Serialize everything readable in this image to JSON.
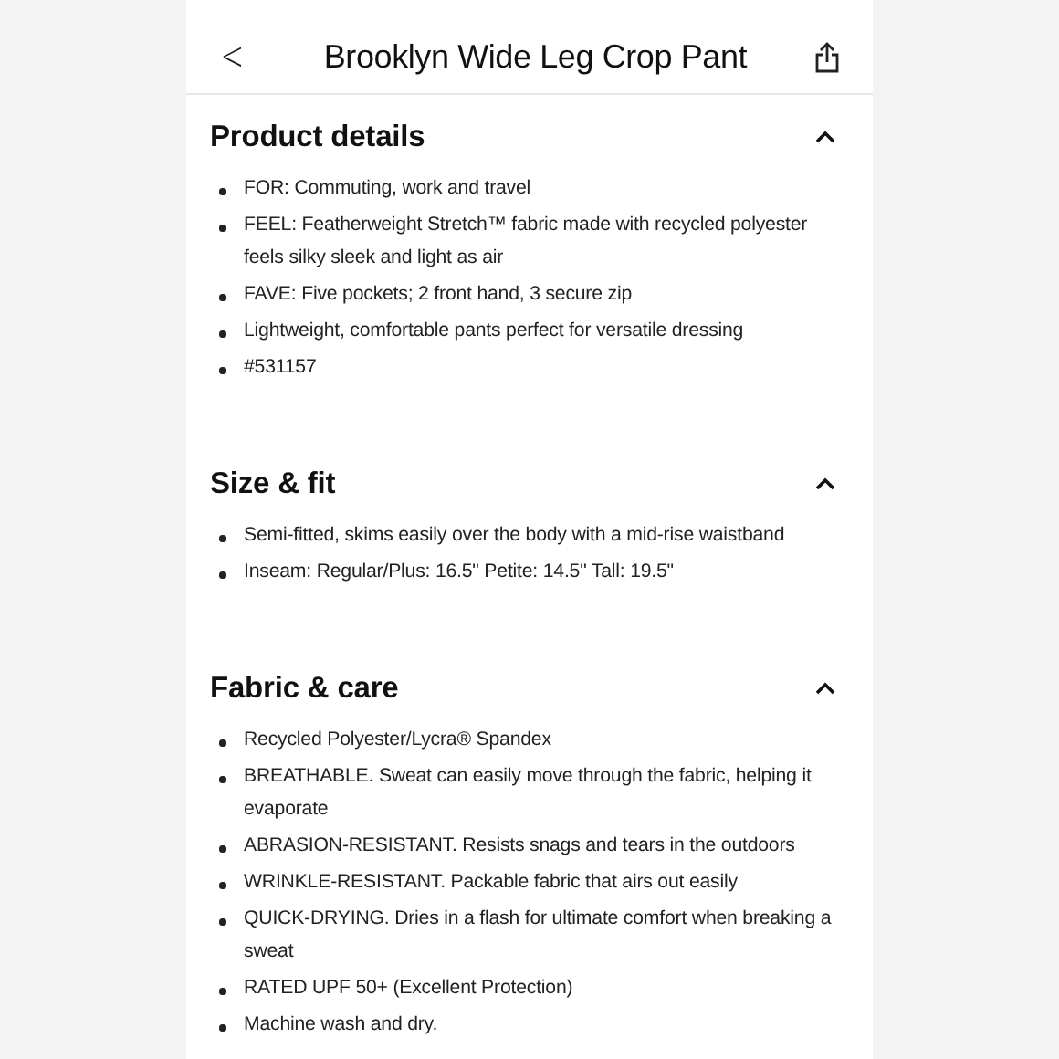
{
  "header": {
    "back": "<",
    "title": "Brooklyn Wide Leg Crop Pant"
  },
  "sections": [
    {
      "title": "Product details",
      "expanded": true,
      "items": [
        "FOR: Commuting, work and travel",
        "FEEL: Featherweight Stretch™ fabric made with recycled polyester feels silky sleek and light as air",
        "FAVE: Five pockets; 2 front hand, 3 secure zip",
        "Lightweight, comfortable pants perfect for versatile dressing",
        "#531157"
      ]
    },
    {
      "title": "Size & fit",
      "expanded": true,
      "items": [
        "Semi-fitted, skims easily over the body with a mid-rise waistband",
        "Inseam: Regular/Plus: 16.5\" Petite: 14.5\" Tall: 19.5\""
      ]
    },
    {
      "title": "Fabric & care",
      "expanded": true,
      "items": [
        "Recycled Polyester/Lycra® Spandex",
        "BREATHABLE. Sweat can easily move through the fabric, helping it evaporate",
        "ABRASION-RESISTANT. Resists snags and tears in the outdoors",
        "WRINKLE-RESISTANT. Packable fabric that airs out easily",
        "QUICK-DRYING. Dries in a flash for ultimate comfort when breaking a sweat",
        "RATED UPF 50+ (Excellent Protection)",
        "Machine wash and dry."
      ]
    }
  ]
}
